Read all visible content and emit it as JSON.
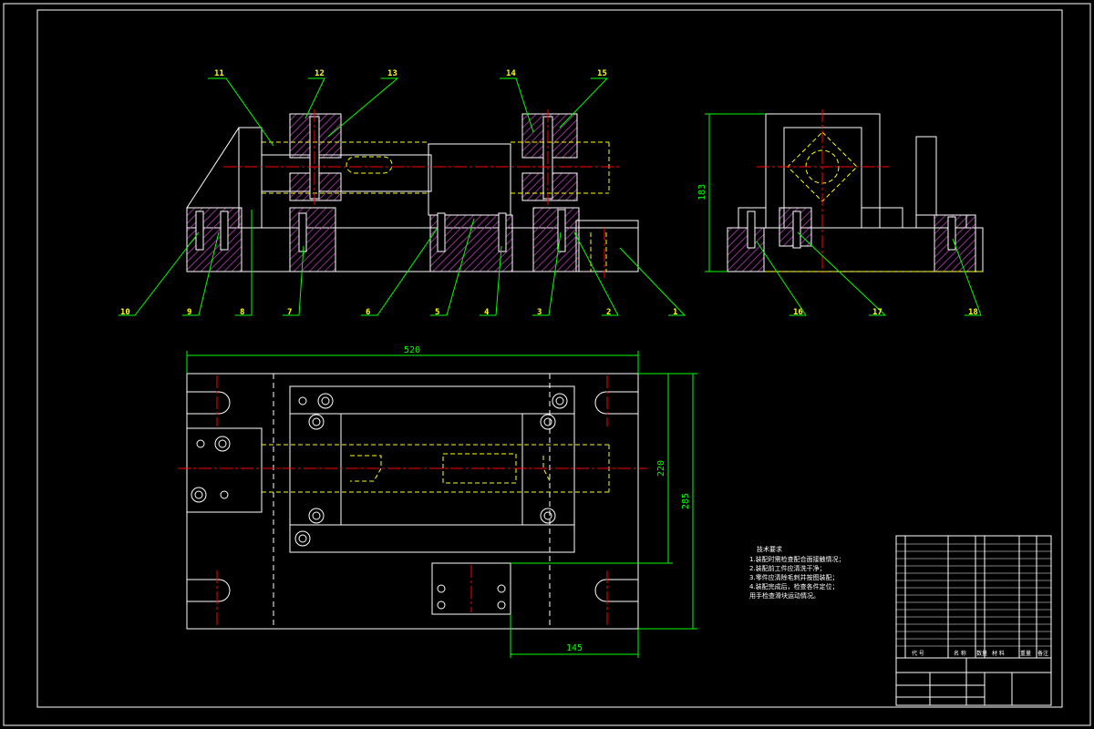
{
  "drawing": {
    "callouts_top": [
      "11",
      "12",
      "13",
      "14",
      "15"
    ],
    "callouts_bottom": [
      "10",
      "9",
      "8",
      "7",
      "6",
      "5",
      "4",
      "3",
      "2",
      "1"
    ],
    "callouts_side": [
      "16",
      "17",
      "18"
    ],
    "dimensions": {
      "width_total": "520",
      "height_inner": "220",
      "height_total": "285",
      "offset_bottom": "145",
      "side_height": "183"
    },
    "tech_notes": {
      "heading": "技术要求",
      "lines": [
        "1.装配时需检查配合面接触情况；",
        "2.装配前工件应清洗干净；",
        "3.零件应清除毛刺并按图装配；",
        "4.装配完成后，检查各件定位；",
        "用手检查滑块运动情况。"
      ]
    },
    "title_block": {
      "header_code": "代 号",
      "header_name": "名 称",
      "header_qty": "数量",
      "header_material": "材 料",
      "header_weight": "重量",
      "header_remark": "备注"
    },
    "colors": {
      "background": "#000000",
      "line": "#ffffff",
      "leader": "#00ff00",
      "hidden": "#ffff00",
      "center": "#ff0000",
      "hatch": "#c040c0",
      "callout_text": "#ffff00"
    }
  }
}
